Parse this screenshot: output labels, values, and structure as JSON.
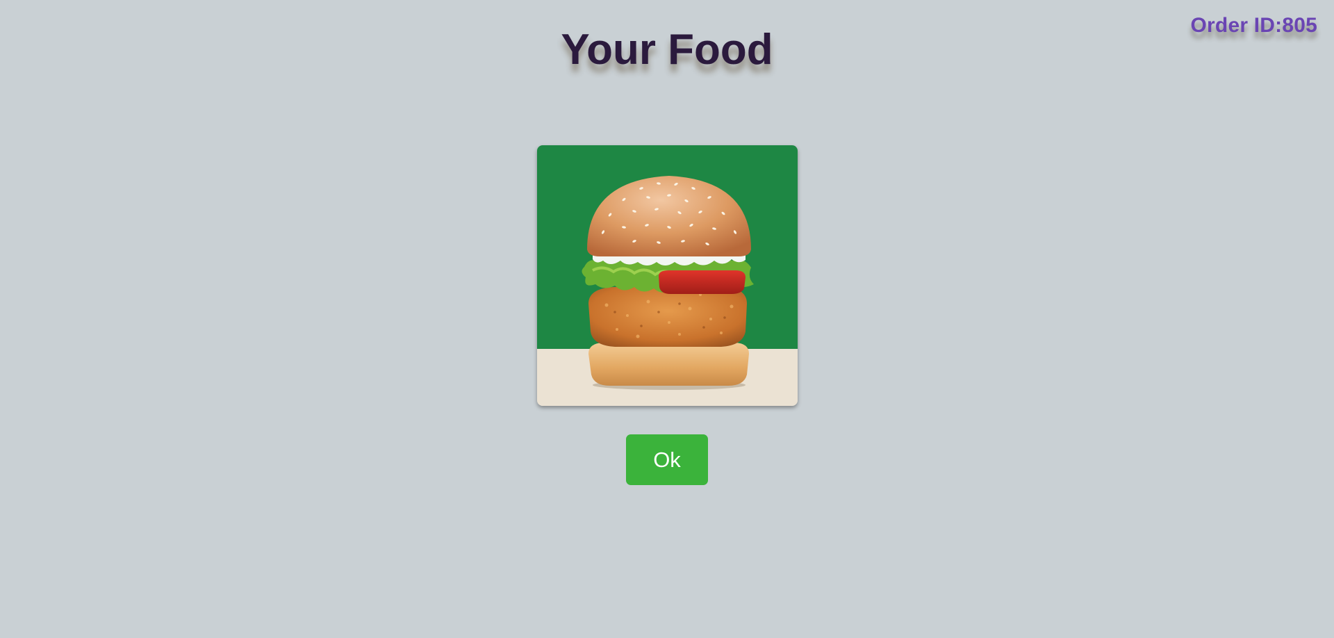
{
  "header": {
    "title": "Your Food",
    "order_id": "Order ID:805"
  },
  "food": {
    "image_icon": "burger-image",
    "colors": {
      "background_green": "#1e8744",
      "floor_beige": "#ebe2d3"
    }
  },
  "actions": {
    "ok_label": "Ok",
    "ok_color": "#3bb33b"
  }
}
